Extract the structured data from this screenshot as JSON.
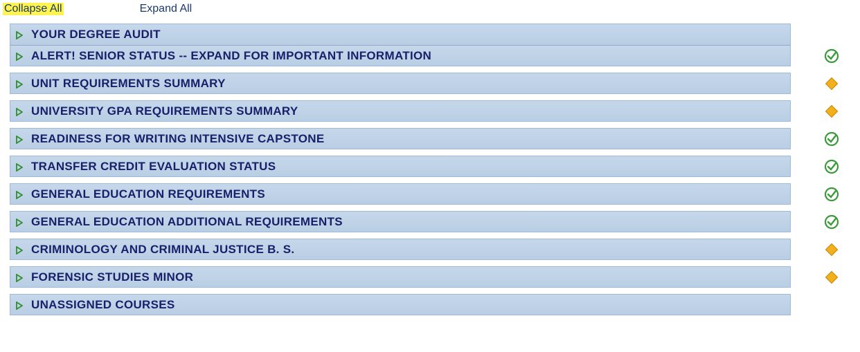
{
  "toplinks": {
    "collapse": "Collapse All",
    "expand": "Expand All"
  },
  "rows": [
    {
      "title": "YOUR DEGREE AUDIT",
      "status": "none"
    },
    {
      "title": "ALERT! SENIOR STATUS -- EXPAND FOR IMPORTANT INFORMATION",
      "status": "complete"
    },
    {
      "title": "UNIT REQUIREMENTS SUMMARY",
      "status": "inprogress"
    },
    {
      "title": "UNIVERSITY GPA REQUIREMENTS SUMMARY",
      "status": "inprogress"
    },
    {
      "title": "READINESS FOR WRITING INTENSIVE CAPSTONE",
      "status": "complete"
    },
    {
      "title": "TRANSFER CREDIT EVALUATION STATUS",
      "status": "complete"
    },
    {
      "title": "GENERAL EDUCATION REQUIREMENTS",
      "status": "complete"
    },
    {
      "title": "GENERAL EDUCATION ADDITIONAL REQUIREMENTS",
      "status": "complete"
    },
    {
      "title": "CRIMINOLOGY AND CRIMINAL JUSTICE B. S.",
      "status": "inprogress"
    },
    {
      "title": "FORENSIC STUDIES MINOR",
      "status": "inprogress"
    },
    {
      "title": "UNASSIGNED COURSES",
      "status": "none"
    }
  ]
}
